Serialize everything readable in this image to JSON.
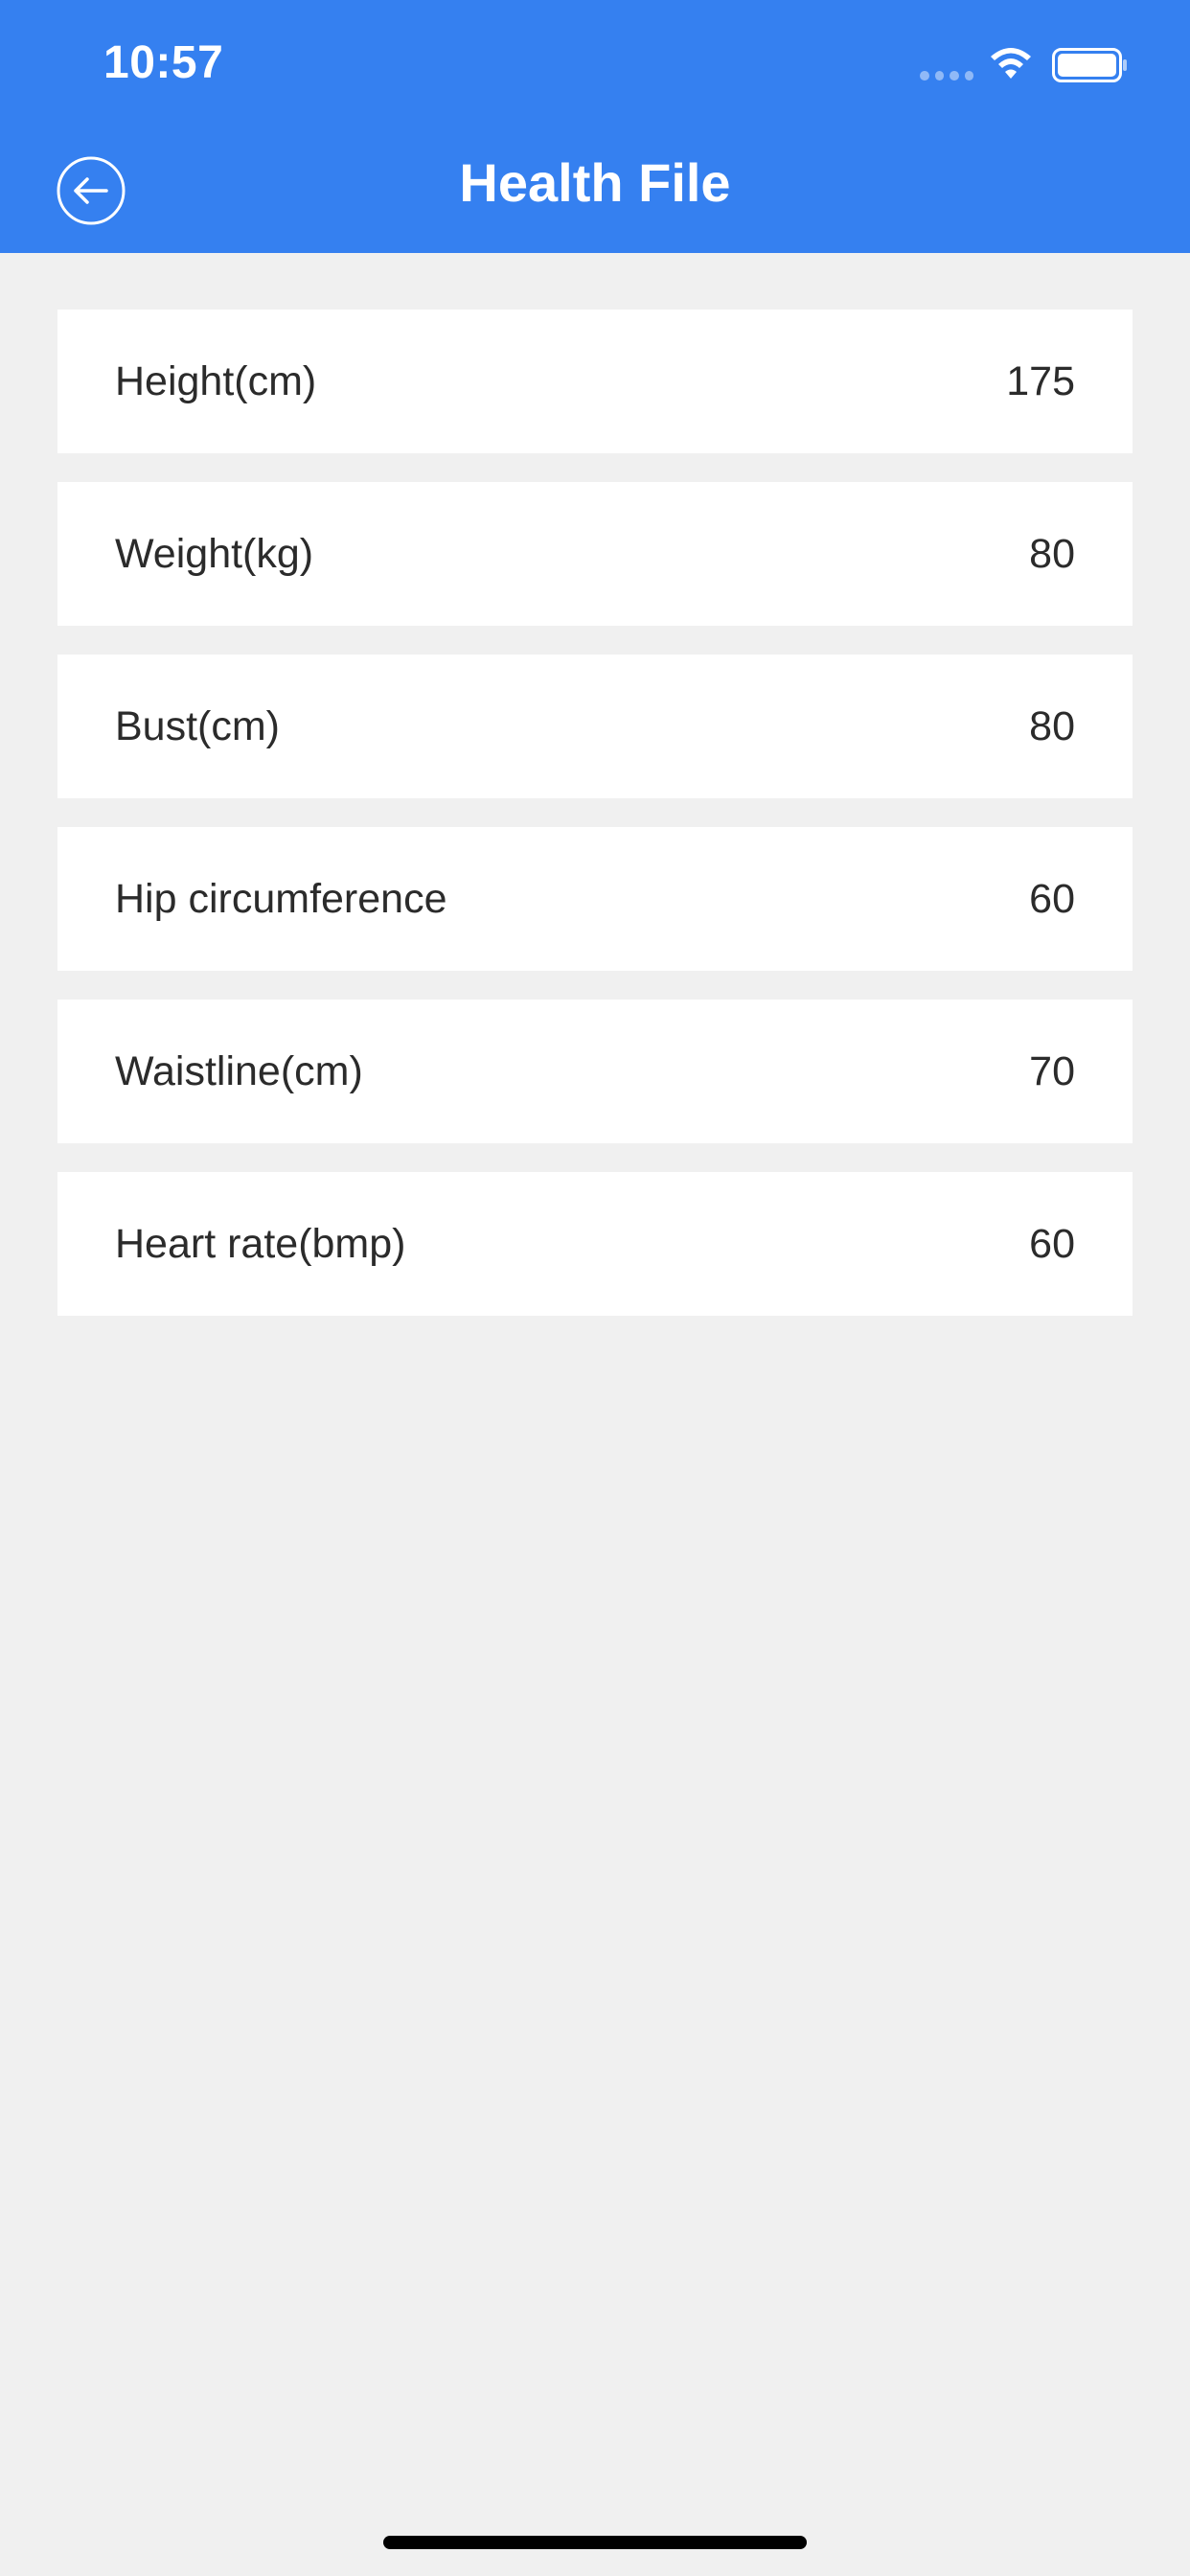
{
  "status_bar": {
    "time": "10:57"
  },
  "header": {
    "title": "Health File",
    "background_color": "#3580F0"
  },
  "items": [
    {
      "label": "Height(cm)",
      "value": "175"
    },
    {
      "label": "Weight(kg)",
      "value": "80"
    },
    {
      "label": "Bust(cm)",
      "value": "80"
    },
    {
      "label": "Hip circumference",
      "value": "60"
    },
    {
      "label": "Waistline(cm)",
      "value": "70"
    },
    {
      "label": "Heart rate(bmp)",
      "value": "60"
    }
  ],
  "icons": {
    "back": "back-arrow-icon",
    "wifi": "wifi-icon",
    "battery": "battery-icon",
    "signal": "signal-icon"
  }
}
